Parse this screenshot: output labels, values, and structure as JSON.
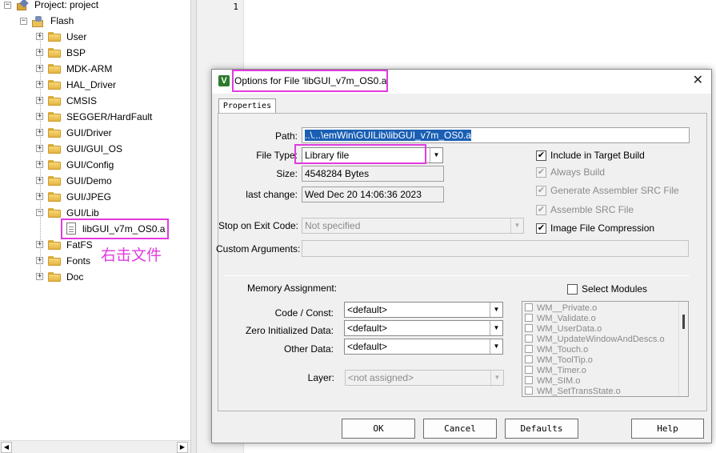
{
  "tree": {
    "project_label": "Project: project",
    "target_label": "Flash",
    "folders": [
      "User",
      "BSP",
      "MDK-ARM",
      "HAL_Driver",
      "CMSIS",
      "SEGGER/HardFault",
      "GUI/Driver",
      "GUI/GUI_OS",
      "GUI/Config",
      "GUI/Demo",
      "GUI/JPEG",
      "GUI/Lib"
    ],
    "file_label": "libGUI_v7m_OS0.a",
    "folders_after": [
      "FatFS",
      "Fonts",
      "Doc"
    ],
    "annotation": "右击文件"
  },
  "editor": {
    "line_number": "1"
  },
  "dialog": {
    "title": "Options for File 'libGUI_v7m_OS0.a'",
    "close_glyph": "✕",
    "tab_label": "Properties",
    "path_label": "Path:",
    "path_value": "..\\...\\emWin\\GUILib\\libGUI_v7m_OS0.a",
    "file_type_label": "File Type:",
    "file_type_value": "Library file",
    "size_label": "Size:",
    "size_value": "4548284 Bytes",
    "last_change_label": "last change:",
    "last_change_value": "Wed Dec 20 14:06:36 2023",
    "include_target": "Include in Target Build",
    "always_build": "Always Build",
    "gen_asm": "Generate Assembler SRC File",
    "assemble_src": "Assemble SRC File",
    "image_compression": "Image File Compression",
    "stop_label": "Stop on Exit Code:",
    "stop_value": "Not specified",
    "custom_args_label": "Custom Arguments:",
    "mem_assign_label": "Memory Assignment:",
    "select_modules": "Select Modules",
    "code_const_label": "Code / Const:",
    "zero_init_label": "Zero Initialized Data:",
    "other_data_label": "Other Data:",
    "default_value": "<default>",
    "layer_label": "Layer:",
    "layer_value": "<not assigned>",
    "modules": [
      "WM__Private.o",
      "WM_Validate.o",
      "WM_UserData.o",
      "WM_UpdateWindowAndDescs.o",
      "WM_Touch.o",
      "WM_ToolTip.o",
      "WM_Timer.o",
      "WM_SIM.o",
      "WM_SetTransState.o"
    ],
    "ok": "OK",
    "cancel": "Cancel",
    "defaults": "Defaults",
    "help": "Help"
  },
  "colors": {
    "highlight": "#e13be0",
    "selection": "#1a5fb4"
  }
}
